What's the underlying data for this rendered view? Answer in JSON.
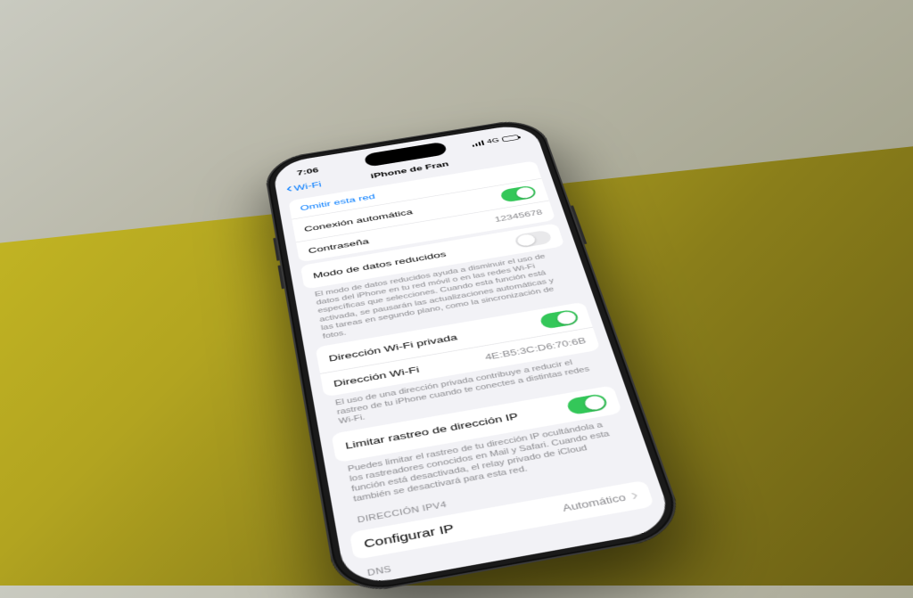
{
  "statusbar": {
    "time": "7:06",
    "network_label": "4G"
  },
  "nav": {
    "back_label": "Wi-Fi",
    "title": "iPhone de Fran"
  },
  "rows": {
    "forget": "Omitir esta red",
    "auto_connect": "Conexión automática",
    "password_label": "Contraseña",
    "password_value": "12345678",
    "low_data_mode": "Modo de datos reducidos",
    "private_addr": "Dirección Wi-Fi privada",
    "wifi_addr_label": "Dirección Wi-Fi",
    "wifi_addr_value": "4E:B5:3C:D6:70:6B",
    "limit_ip_tracking": "Limitar rastreo de dirección IP",
    "configure_ip_label": "Configurar IP",
    "configure_ip_value": "Automático"
  },
  "notes": {
    "low_data": "El modo de datos reducidos ayuda a disminuir el uso de datos del iPhone en tu red móvil o en las redes Wi-Fi específicas que selecciones. Cuando esta función está activada, se pausarán las actualizaciones automáticas y las tareas en segundo plano, como la sincronización de fotos.",
    "private_addr": "El uso de una dirección privada contribuye a reducir el rastreo de tu iPhone cuando te conectes a distintas redes Wi-Fi.",
    "limit_ip": "Puedes limitar el rastreo de tu dirección IP ocultándola a los rastreadores conocidos en Mail y Safari. Cuando esta función está desactivada, el relay privado de iCloud también se desactivará para esta red."
  },
  "sections": {
    "ipv4_header": "DIRECCIÓN IPV4",
    "dns_header": "DNS"
  }
}
